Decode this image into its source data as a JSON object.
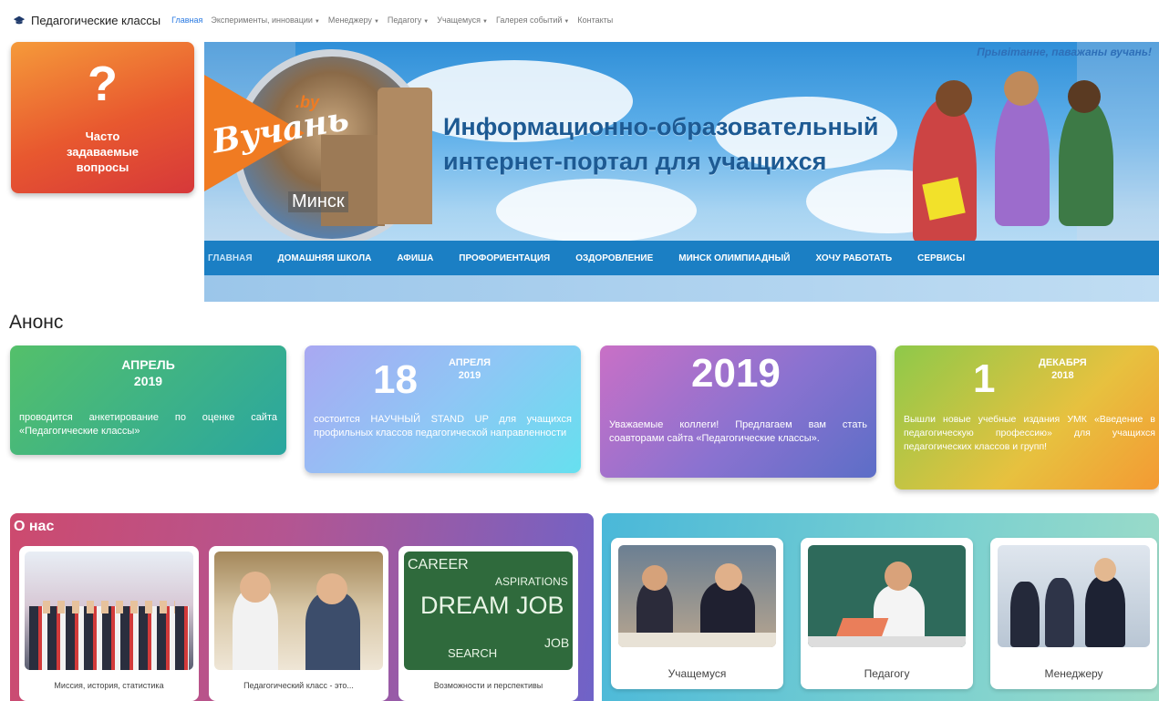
{
  "topnav": {
    "brand": "Педагогические классы",
    "links": [
      {
        "label": "Главная",
        "active": true,
        "dropdown": false
      },
      {
        "label": "Эксперименты, инновации",
        "dropdown": true
      },
      {
        "label": "Менеджеру",
        "dropdown": true
      },
      {
        "label": "Педагогу",
        "dropdown": true
      },
      {
        "label": "Учащемуся",
        "dropdown": true
      },
      {
        "label": "Галерея событий",
        "dropdown": true
      },
      {
        "label": "Контакты",
        "dropdown": false
      }
    ]
  },
  "faq": {
    "symbol": "?",
    "label": "Часто\nзадаваемые\nвопросы"
  },
  "banner": {
    "greeting": "Прывітанне, паважаны вучань!",
    "logo_text": "Вучань",
    "logo_by": ".by",
    "city": "Минск",
    "title": "Информационно-образовательный\nинтернет-портал для учащихся",
    "nav": [
      "ГЛАВНАЯ",
      "ДОМАШНЯЯ ШКОЛА",
      "АФИША",
      "ПРОФОРИЕНТАЦИЯ",
      "ОЗДОРОВЛЕНИЕ",
      "МИНСК ОЛИМПИАДНЫЙ",
      "ХОЧУ РАБОТАТЬ",
      "СЕРВИСЫ"
    ]
  },
  "anons": {
    "title": "Анонс",
    "cards": [
      {
        "head": "АПРЕЛЬ\n2019",
        "text": "проводится анкетирование по оценке сайта «Педагогические классы»"
      },
      {
        "num": "18",
        "date": "АПРЕЛЯ\n2019",
        "text": "состоится НАУЧНЫЙ STAND UP для учащихся профильных классов педагогической направленности"
      },
      {
        "num": "2019",
        "text": "Уважаемые коллеги! Предлагаем вам стать соавторами сайта «Педагогические классы»."
      },
      {
        "num": "1",
        "date": "ДЕКАБРЯ\n2018",
        "text": "Вышли новые учебные издания УМК «Введение в педагогическую профессию» для учащихся педагогических классов и групп!"
      }
    ]
  },
  "about": {
    "title": "О нас",
    "tiles": [
      "Миссия, история, статистика",
      "Педагогический класс - это...",
      "Возможности и перспективы"
    ],
    "dream_words": [
      "CAREER",
      "DREAM JOB",
      "ASPIRATIONS",
      "SEARCH",
      "JOB"
    ]
  },
  "roles": {
    "tiles": [
      "Учащемуся",
      "Педагогу",
      "Менеджеру"
    ]
  },
  "colors": {
    "accent": "#2a7ae2",
    "banner_nav": "#1b7fc4",
    "title_blue": "#1d5a93"
  }
}
